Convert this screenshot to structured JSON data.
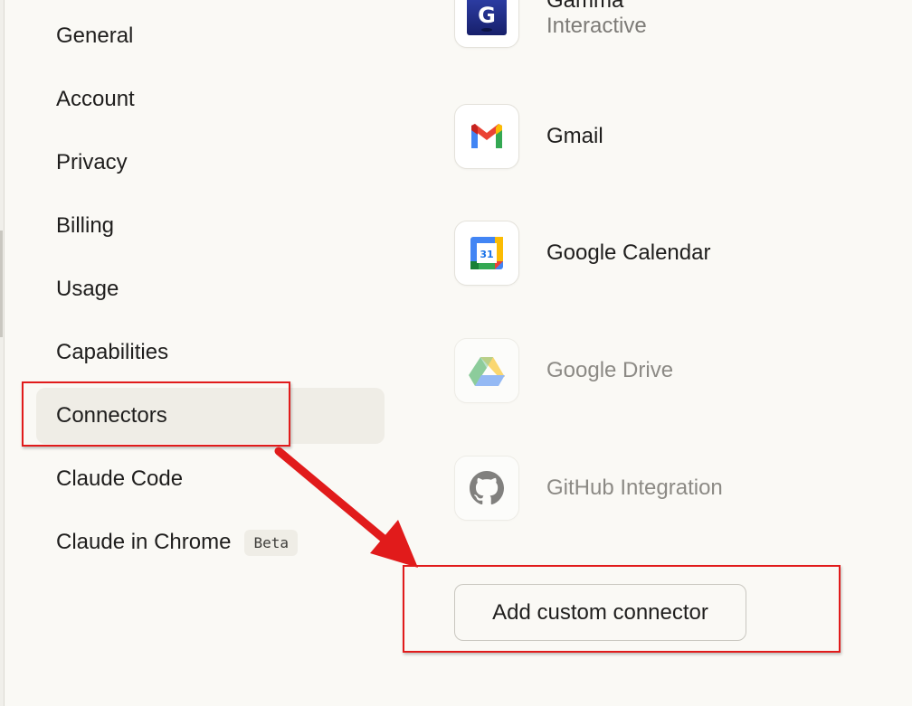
{
  "sidebar": {
    "items": [
      {
        "label": "General"
      },
      {
        "label": "Account"
      },
      {
        "label": "Privacy"
      },
      {
        "label": "Billing"
      },
      {
        "label": "Usage"
      },
      {
        "label": "Capabilities"
      },
      {
        "label": "Connectors",
        "active": true
      },
      {
        "label": "Claude Code"
      },
      {
        "label": "Claude in Chrome",
        "badge": "Beta"
      }
    ]
  },
  "connectors": {
    "items": [
      {
        "name": "Gamma",
        "subtitle": "Interactive",
        "icon": "gamma-icon"
      },
      {
        "name": "Gmail",
        "icon": "gmail-icon"
      },
      {
        "name": "Google Calendar",
        "icon": "google-calendar-icon",
        "calendar_day": "31"
      },
      {
        "name": "Google Drive",
        "icon": "google-drive-icon",
        "disabled": true
      },
      {
        "name": "GitHub Integration",
        "icon": "github-icon",
        "disabled": true
      }
    ],
    "add_button_label": "Add custom connector"
  },
  "annotation": {
    "color": "#e11b1b"
  },
  "colors": {
    "background": "#faf9f5",
    "active_item": "#efede6",
    "text": "#1f1e1d",
    "muted_text": "#8c8a85"
  }
}
